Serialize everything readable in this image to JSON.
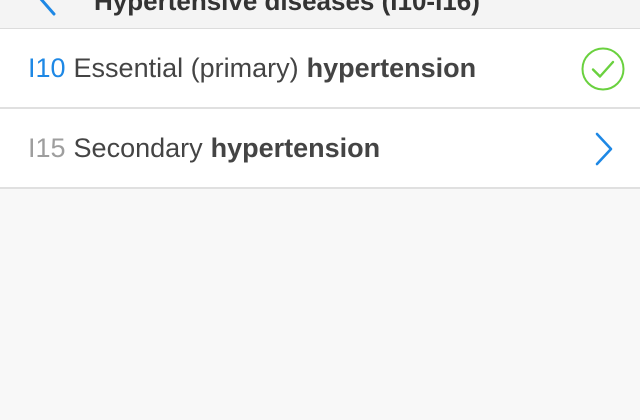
{
  "header": {
    "title": "Hypertensive diseases (I10-I16)"
  },
  "rows": [
    {
      "code": "I10",
      "label": "Essential (primary)",
      "term": "hypertension",
      "status": "selected",
      "icon": "check-circle-icon"
    },
    {
      "code": "I15",
      "label": "Secondary",
      "term": "hypertension",
      "status": "navigable",
      "icon": "chevron-right-icon"
    }
  ],
  "colors": {
    "accent": "#1e88e5",
    "success": "#6ad13f",
    "text": "#444444",
    "muted": "#9e9e9e",
    "background": "#f8f8f8"
  }
}
